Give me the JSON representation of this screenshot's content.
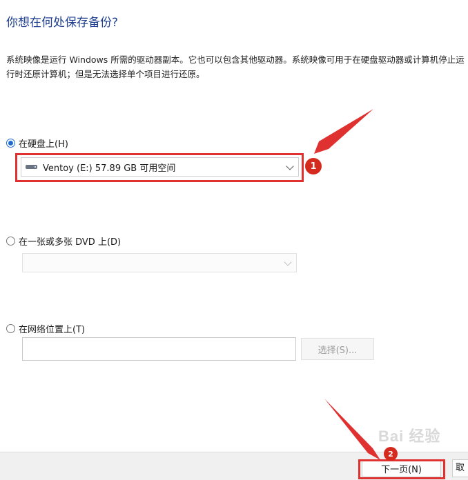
{
  "page": {
    "title": "你想在何处保存备份?",
    "description": "系统映像是运行 Windows 所需的驱动器副本。它也可以包含其他驱动器。系统映像可用于在硬盘驱动器或计算机停止运行时还原计算机；但是无法选择单个项目进行还原。"
  },
  "options": {
    "hard_disk": {
      "label": "在硬盘上(H)",
      "selected": true,
      "drive_value": "Ventoy (E:)  57.89 GB 可用空间"
    },
    "dvd": {
      "label": "在一张或多张 DVD 上(D)",
      "selected": false,
      "drive_value": ""
    },
    "network": {
      "label": "在网络位置上(T)",
      "selected": false,
      "location_value": "",
      "browse_label": "选择(S)..."
    }
  },
  "footer": {
    "next_label": "下一页(N)",
    "cancel_label": "取"
  },
  "annotations": {
    "step1": "1",
    "step2": "2",
    "watermark": "Bai 经验",
    "highlight_color": "#e03131",
    "badge_color": "#d52b1e"
  }
}
